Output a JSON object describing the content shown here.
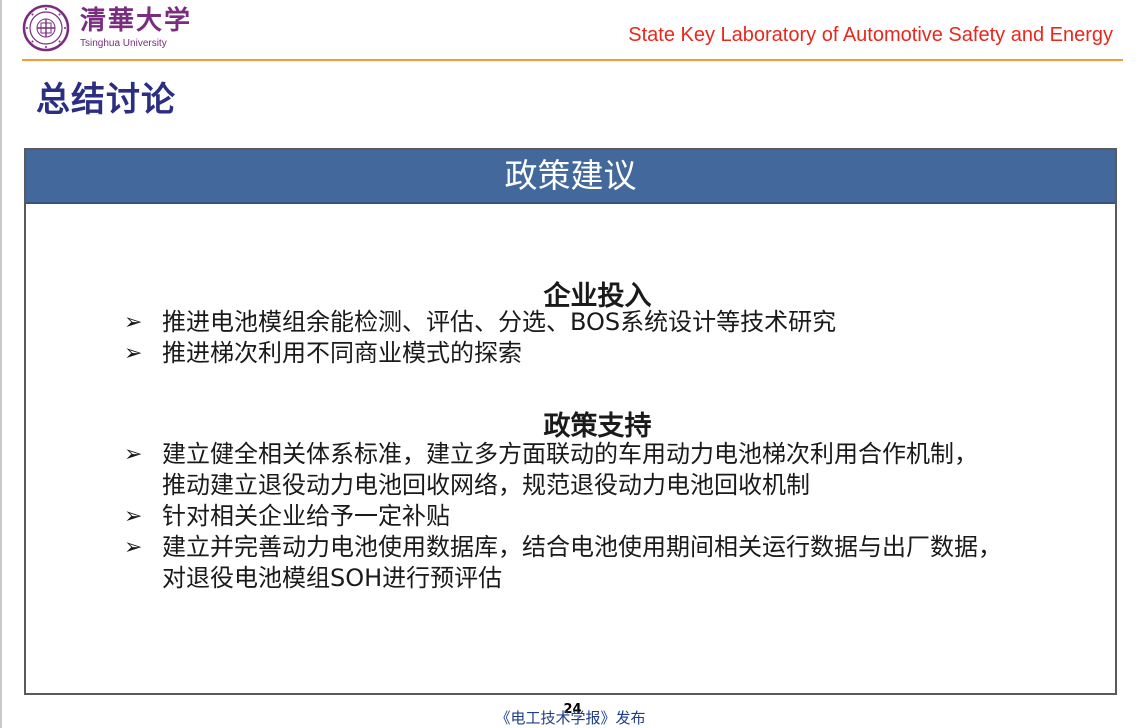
{
  "header": {
    "logo_cn": "清華大学",
    "logo_en": "Tsinghua University",
    "lab_name": "State Key Laboratory of Automotive Safety and Energy"
  },
  "page_title": "总结讨论",
  "box": {
    "title": "政策建议",
    "sections": [
      {
        "heading": "企业投入",
        "bullets": [
          [
            "推进电池模组余能检测、评估、分选、BOS系统设计等技术研究"
          ],
          [
            "推进梯次利用不同商业模式的探索"
          ]
        ]
      },
      {
        "heading": "政策支持",
        "bullets": [
          [
            "建立健全相关体系标准，建立多方面联动的车用动力电池梯次利用合作机制，",
            "推动建立退役动力电池回收网络，规范退役动力电池回收机制"
          ],
          [
            "针对相关企业给予一定补贴"
          ],
          [
            "建立并完善动力电池使用数据库，结合电池使用期间相关运行数据与出厂数据，",
            "对退役电池模组SOH进行预评估"
          ]
        ]
      }
    ]
  },
  "bullet_symbol": "➢",
  "footer": {
    "page_number": "24",
    "source": "《电工技术学报》发布"
  },
  "colors": {
    "brand_purple": "#7a2d7e",
    "lab_red": "#e8281c",
    "title_navy": "#2b2e82",
    "box_header_blue": "#43699c",
    "rule_orange": "#f39c3c"
  }
}
